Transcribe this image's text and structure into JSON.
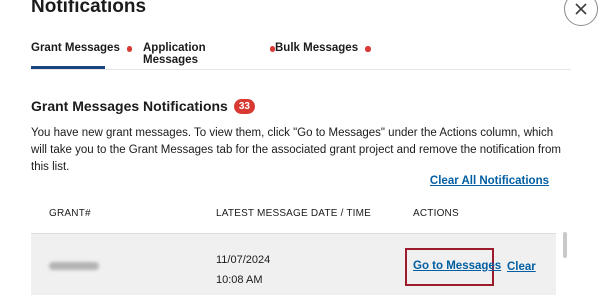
{
  "header": {
    "title": "Notifications"
  },
  "tabs": [
    {
      "label": "Grant Messages",
      "active": true
    },
    {
      "label": "Application Messages",
      "active": false
    },
    {
      "label": "Bulk Messages",
      "active": false
    }
  ],
  "section": {
    "title": "Grant Messages Notifications",
    "count": "33",
    "description": "You have new grant messages. To view them, click \"Go to Messages\" under the Actions column, which will take you to the Grant Messages tab for the associated grant project and remove the notification from this list."
  },
  "clear_all_label": "Clear All Notifications",
  "table": {
    "headers": [
      "GRANT#",
      "LATEST MESSAGE DATE / TIME",
      "ACTIONS"
    ],
    "rows": [
      {
        "date": "11/07/2024",
        "time": "10:08 AM",
        "go_label": "Go to Messages",
        "clear_label": "Clear"
      }
    ]
  },
  "colors": {
    "accent": "#005ea2",
    "badge": "#d83933",
    "highlight": "#9b1c2c",
    "tab_underline": "#1a4480"
  }
}
